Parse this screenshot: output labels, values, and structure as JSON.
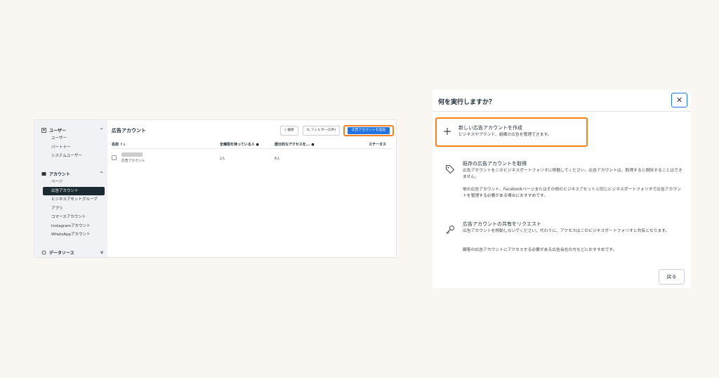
{
  "left": {
    "sidebar": {
      "sections": [
        {
          "label": "ユーザー",
          "items": [
            "ユーザー",
            "パートナー",
            "システムユーザー"
          ]
        },
        {
          "label": "アカウント",
          "items": [
            "ページ",
            "広告アカウント",
            "ビジネスアセットグループ",
            "アプリ",
            "コマースアカウント",
            "Instagramアカウント",
            "WhatsAppアカウント"
          ]
        },
        {
          "label": "データソース"
        }
      ],
      "active_item": "広告アカウント"
    },
    "main": {
      "title": "広告アカウント",
      "search_label": "検索",
      "filter_label": "フィルター(1件)",
      "add_button": "広告アカウントを追加",
      "columns": [
        "名前 ↑↓",
        "全権限を持っている人",
        "部分的なアクセスを...",
        "ステータス"
      ],
      "row": {
        "name_sub": "広告アカウント",
        "full_access": "2人",
        "partial_access": "6人"
      }
    }
  },
  "dialog": {
    "title": "何を実行しますか？",
    "close_label": "✕",
    "options": [
      {
        "icon": "plus-icon",
        "title": "新しい広告アカウントを作成",
        "desc": "ビジネスやブランド、組織の広告を管理できます。"
      },
      {
        "icon": "tag-icon",
        "title": "既存の広告アカウントを取得",
        "desc": "広告アカウントをこのビジネスポートフォリオに移動してください。広告アカウントは、取得すると削除することはできません。",
        "desc2": "他の広告アカウント、Facebookページまたはその他のビジネスアセットと同じビジネスポートフォリオで広告アカウントを管理する必要がある場合におすすめです。"
      },
      {
        "icon": "key-icon",
        "title": "広告アカウントの共有をリクエスト",
        "desc": "広告アカウントを移動しないでください。代わりに、アクセスはこのビジネスポートフォリオと共有となります。",
        "desc2": "顧客の広告アカウントにアクセスする必要がある広告会社の方などにおすすめです。"
      }
    ],
    "back_button": "戻る"
  },
  "colors": {
    "accent": "#2374e1",
    "highlight": "#f5821f",
    "background": "#faf6f1"
  }
}
